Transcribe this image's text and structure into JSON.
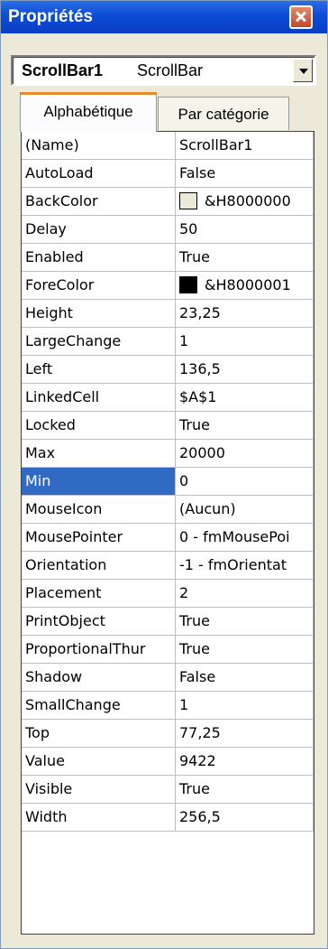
{
  "window": {
    "title": "Propriétés"
  },
  "object_selector": {
    "name": "ScrollBar1",
    "type": "ScrollBar"
  },
  "tabs": [
    {
      "label": "Alphabétique",
      "active": true
    },
    {
      "label": "Par catégorie",
      "active": false
    }
  ],
  "properties": [
    {
      "name": "(Name)",
      "value": "ScrollBar1"
    },
    {
      "name": "AutoLoad",
      "value": "False"
    },
    {
      "name": "BackColor",
      "value": "&H8000000",
      "swatch": "#ece9d8"
    },
    {
      "name": "Delay",
      "value": "50"
    },
    {
      "name": "Enabled",
      "value": "True"
    },
    {
      "name": "ForeColor",
      "value": "&H8000001",
      "swatch": "#000000"
    },
    {
      "name": "Height",
      "value": "23,25"
    },
    {
      "name": "LargeChange",
      "value": "1"
    },
    {
      "name": "Left",
      "value": "136,5"
    },
    {
      "name": "LinkedCell",
      "value": "$A$1"
    },
    {
      "name": "Locked",
      "value": "True"
    },
    {
      "name": "Max",
      "value": "20000"
    },
    {
      "name": "Min",
      "value": "0",
      "selected": true
    },
    {
      "name": "MouseIcon",
      "value": "(Aucun)"
    },
    {
      "name": "MousePointer",
      "value": "0 - fmMousePoi"
    },
    {
      "name": "Orientation",
      "value": "-1 - fmOrientat"
    },
    {
      "name": "Placement",
      "value": "2"
    },
    {
      "name": "PrintObject",
      "value": "True"
    },
    {
      "name": "ProportionalThur",
      "value": "True"
    },
    {
      "name": "Shadow",
      "value": "False"
    },
    {
      "name": "SmallChange",
      "value": "1"
    },
    {
      "name": "Top",
      "value": "77,25"
    },
    {
      "name": "Value",
      "value": "9422"
    },
    {
      "name": "Visible",
      "value": "True"
    },
    {
      "name": "Width",
      "value": "256,5"
    }
  ],
  "colors": {
    "titlebar": "#0c4cd6",
    "selection": "#316ac5",
    "active_tab_accent": "#e68b2c"
  }
}
